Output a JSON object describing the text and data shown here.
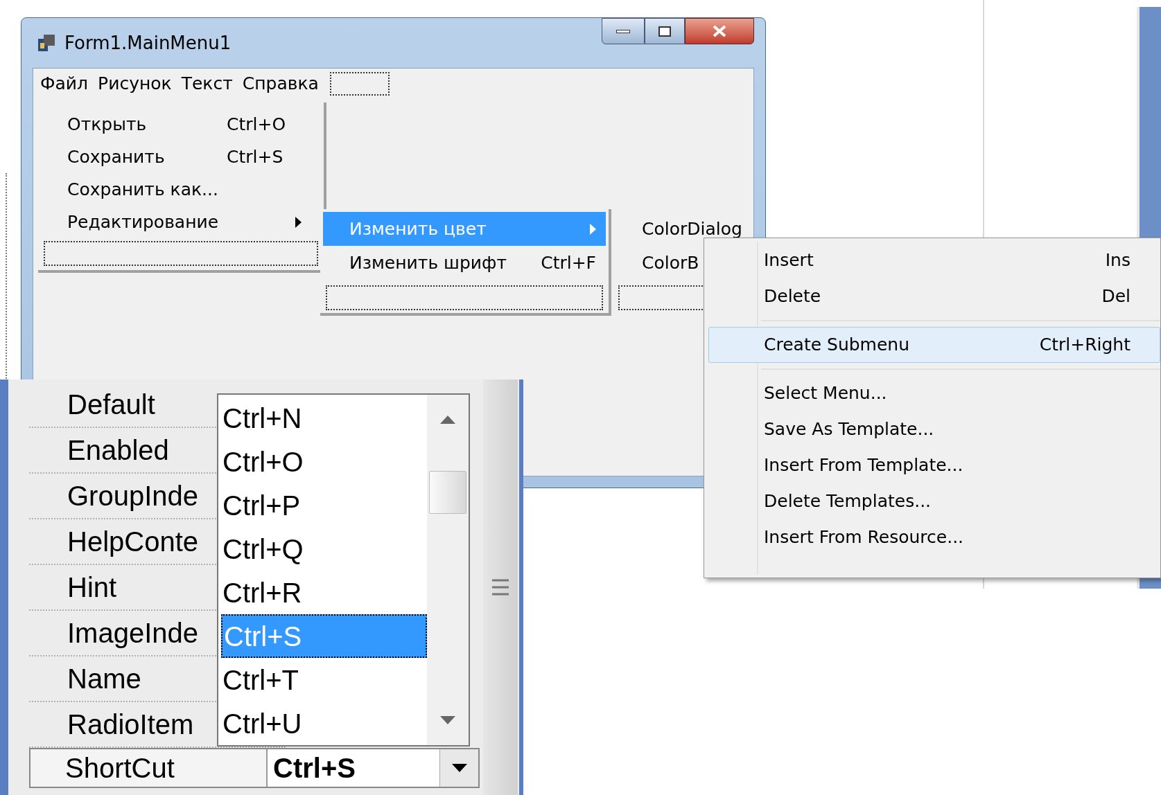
{
  "form_window": {
    "title": "Form1.MainMenu1",
    "menu_bar": [
      "Файл",
      "Рисунок",
      "Текст",
      "Справка"
    ],
    "file_menu": [
      {
        "label": "Открыть",
        "shortcut": "Ctrl+O",
        "has_submenu": false
      },
      {
        "label": "Сохранить",
        "shortcut": "Ctrl+S",
        "has_submenu": false
      },
      {
        "label": "Сохранить как...",
        "has_submenu": false
      },
      {
        "label": "Редактирование",
        "has_submenu": true
      }
    ],
    "edit_submenu": [
      {
        "label": "Изменить цвет",
        "selected": true,
        "has_submenu": true
      },
      {
        "label": "Изменить шрифт",
        "shortcut": "Ctrl+F",
        "selected": false,
        "has_submenu": false
      }
    ],
    "color_submenu": [
      "ColorDialog",
      "ColorB"
    ]
  },
  "context_menu": {
    "groups": [
      [
        {
          "label": "Insert",
          "shortcut": "Ins",
          "selected": false
        },
        {
          "label": "Delete",
          "shortcut": "Del",
          "selected": false
        }
      ],
      [
        {
          "label": "Create Submenu",
          "shortcut": "Ctrl+Right",
          "selected": true
        }
      ],
      [
        {
          "label": "Select Menu...",
          "selected": false
        },
        {
          "label": "Save As Template...",
          "selected": false
        },
        {
          "label": "Insert From Template...",
          "selected": false
        },
        {
          "label": "Delete Templates...",
          "selected": false
        },
        {
          "label": "Insert From Resource...",
          "selected": false
        }
      ]
    ]
  },
  "object_inspector": {
    "properties": [
      "Default",
      "Enabled",
      "GroupInde",
      "HelpConte",
      "Hint",
      "ImageInde",
      "Name",
      "RadioItem"
    ],
    "shortcut_list": [
      {
        "label": "Ctrl+N",
        "selected": false
      },
      {
        "label": "Ctrl+O",
        "selected": false
      },
      {
        "label": "Ctrl+P",
        "selected": false
      },
      {
        "label": "Ctrl+Q",
        "selected": false
      },
      {
        "label": "Ctrl+R",
        "selected": false
      },
      {
        "label": "Ctrl+S",
        "selected": true
      },
      {
        "label": "Ctrl+T",
        "selected": false
      },
      {
        "label": "Ctrl+U",
        "selected": false
      }
    ],
    "current_row": {
      "name": "ShortCut",
      "value": "Ctrl+S"
    }
  }
}
